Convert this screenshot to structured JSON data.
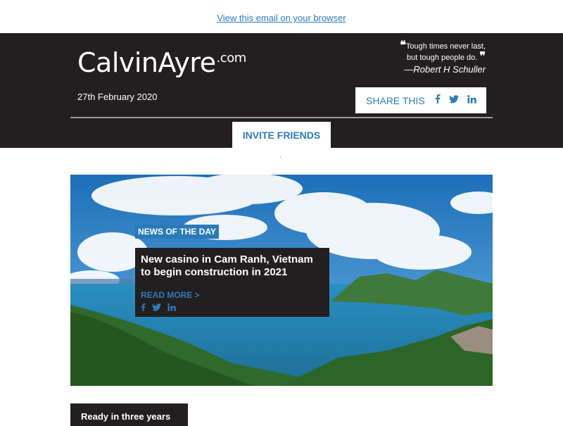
{
  "email": {
    "view_in_browser": "View this email on your browser"
  },
  "header": {
    "logo_main": "CalvinAyre",
    "logo_suffix": ".com",
    "quote_open": "❝",
    "quote_line1": "Tough times never last,",
    "quote_line2": "but tough people do.",
    "quote_close": "❞",
    "quote_author": "—Robert H Schuller",
    "date": "27th February 2020",
    "share_label": "SHARE THIS",
    "share_icons": [
      "facebook-icon",
      "twitter-icon",
      "linkedin-icon"
    ],
    "invite_label": "INVITE FRIENDS"
  },
  "tick_mark": "`",
  "featured": {
    "tag": "NEWS OF THE DAY",
    "title_line1": "New casino in Cam Ranh, Vietnam",
    "title_line2": "to begin construction in 2021",
    "read_more": "READ MORE >",
    "icons": [
      "facebook-icon",
      "twitter-icon",
      "linkedin-icon"
    ]
  },
  "section": {
    "subheading": "Ready in three years"
  },
  "colors": {
    "dark": "#231f20",
    "accent_blue": "#2f7bbd",
    "tag_blue": "#2a7ab8",
    "white": "#ffffff"
  }
}
